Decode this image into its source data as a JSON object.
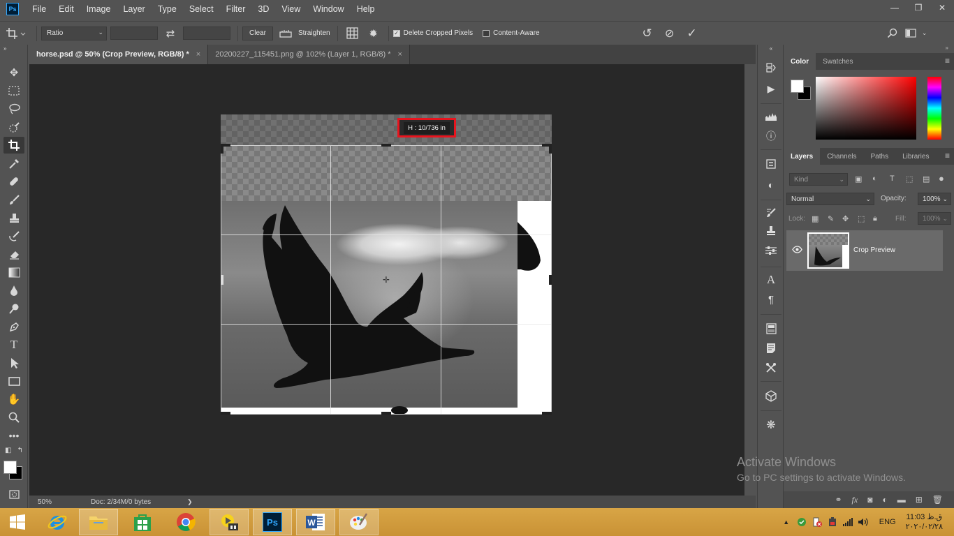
{
  "app": {
    "logo": "Ps"
  },
  "menu": [
    "File",
    "Edit",
    "Image",
    "Layer",
    "Type",
    "Select",
    "Filter",
    "3D",
    "View",
    "Window",
    "Help"
  ],
  "window_controls": {
    "minimize": "—",
    "restore": "❐",
    "close": "✕"
  },
  "options": {
    "ratio": "Ratio",
    "swap_icon": "⇄",
    "clear": "Clear",
    "straighten": "Straighten",
    "delete_cropped": "Delete Cropped Pixels",
    "delete_cropped_checked": true,
    "content_aware": "Content-Aware",
    "content_aware_checked": false
  },
  "tabs": [
    {
      "label": "horse.psd @ 50% (Crop Preview, RGB/8) *",
      "close": "×",
      "active": true
    },
    {
      "label": "20200227_115451.png @ 102% (Layer 1, RGB/8) *",
      "close": "×",
      "active": false
    }
  ],
  "canvas": {
    "hud_text": "H :  10/736 in"
  },
  "status": {
    "zoom": "50%",
    "doc": "Doc: 2/34M/0 bytes",
    "arrow": "❯"
  },
  "color_panel": {
    "tabs": [
      "Color",
      "Swatches"
    ],
    "active": "Color"
  },
  "layers_panel": {
    "tabs": [
      "Layers",
      "Channels",
      "Paths",
      "Libraries"
    ],
    "active": "Layers",
    "kind_placeholder": "Kind",
    "blend_mode": "Normal",
    "opacity_label": "Opacity:",
    "opacity": "100%",
    "lock_label": "Lock:",
    "fill_label": "Fill:",
    "fill": "100%",
    "layers": [
      {
        "name": "Crop Preview",
        "visible": true
      }
    ]
  },
  "watermark": {
    "title": "Activate Windows",
    "subtitle": "Go to PC settings to activate Windows."
  },
  "taskbar": {
    "tray": {
      "lang": "ENG",
      "time": "11:03 ق.ظ",
      "date": "۲۰۲۰/۰۲/۲۸"
    }
  },
  "colors": {
    "hud_border": "#e8141e",
    "ps_blue": "#31a8ff",
    "taskbar": "#d4a044"
  }
}
